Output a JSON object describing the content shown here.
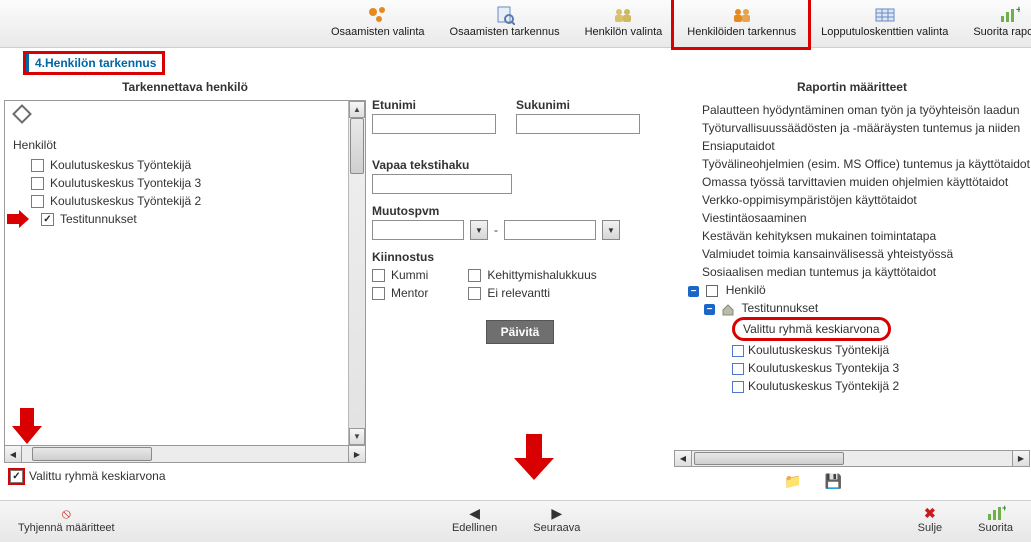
{
  "toolbar": {
    "items": [
      {
        "label": "Osaamisten valinta"
      },
      {
        "label": "Osaamisten tarkennus"
      },
      {
        "label": "Henkilön valinta"
      },
      {
        "label": "Henkilöiden tarkennus"
      },
      {
        "label": "Lopputuloskenttien valinta"
      },
      {
        "label": "Suorita raportti"
      }
    ]
  },
  "page": {
    "title": "4.Henkilön tarkennus"
  },
  "left": {
    "header": "Tarkennettava henkilö",
    "group": "Henkilöt",
    "items": [
      {
        "label": "Koulutuskeskus Työntekijä",
        "checked": false
      },
      {
        "label": "Koulutuskeskus Tyontekija 3",
        "checked": false
      },
      {
        "label": "Koulutuskeskus Työntekijä 2",
        "checked": false
      },
      {
        "label": "Testitunnukset",
        "checked": true
      }
    ],
    "avg_checkbox_label": "Valittu ryhmä keskiarvona"
  },
  "mid": {
    "firstname": "Etunimi",
    "lastname": "Sukunimi",
    "freetext": "Vapaa tekstihaku",
    "changedate": "Muutospvm",
    "dash": "-",
    "interest": "Kiinnostus",
    "kummi": "Kummi",
    "mentor": "Mentor",
    "kehitt": "Kehittymishalukkuus",
    "eirel": "Ei relevantti",
    "update": "Päivitä"
  },
  "right": {
    "header": "Raportin määritteet",
    "lines": [
      "Palautteen hyödyntäminen oman työn ja työyhteisön laadun",
      "Työturvallisuussäädösten ja -määräysten tuntemus ja niiden",
      "Ensiaputaidot",
      "Työvälineohjelmien (esim. MS Office) tuntemus ja käyttötaidot",
      "Omassa työssä tarvittavien muiden ohjelmien käyttötaidot",
      "Verkko-oppimisympäristöjen käyttötaidot",
      "Viestintäosaaminen",
      "Kestävän kehityksen mukainen toimintatapa",
      "Valmiudet toimia kansainvälisessä yhteistyössä",
      "Sosiaalisen median tuntemus ja käyttötaidot"
    ],
    "tree": {
      "root": "Henkilö",
      "child": "Testitunnukset",
      "avg": "Valittu ryhmä keskiarvona",
      "people": [
        "Koulutuskeskus Työntekijä",
        "Koulutuskeskus Tyontekija 3",
        "Koulutuskeskus Työntekijä 2"
      ]
    }
  },
  "footer": {
    "clear": "Tyhjennä määritteet",
    "prev": "Edellinen",
    "next": "Seuraava",
    "close": "Sulje",
    "run": "Suorita"
  }
}
